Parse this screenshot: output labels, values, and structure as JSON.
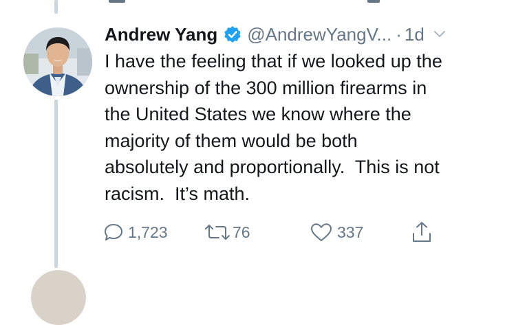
{
  "tweet": {
    "author": {
      "display_name": "Andrew Yang",
      "verified": true,
      "handle": "@AndrewYangV...",
      "avatar": "avatar-photo"
    },
    "separator": "·",
    "time": "1d",
    "text": "I have the feeling that if we looked up the\nownership of the 300 million firearms in\nthe United States we know where the\nmajority of them would be both\nabsolutely and proportionally.  This is not\nracism.  It’s math.",
    "actions": {
      "reply": {
        "icon": "reply-icon",
        "count": "1,723"
      },
      "retweet": {
        "icon": "retweet-icon",
        "count": "76"
      },
      "like": {
        "icon": "like-icon",
        "count": "337"
      },
      "share": {
        "icon": "share-icon"
      }
    }
  },
  "colors": {
    "text": "#14171a",
    "muted": "#657786",
    "verified_badge": "#1da1f2",
    "thread_line": "#ccd6dd"
  }
}
